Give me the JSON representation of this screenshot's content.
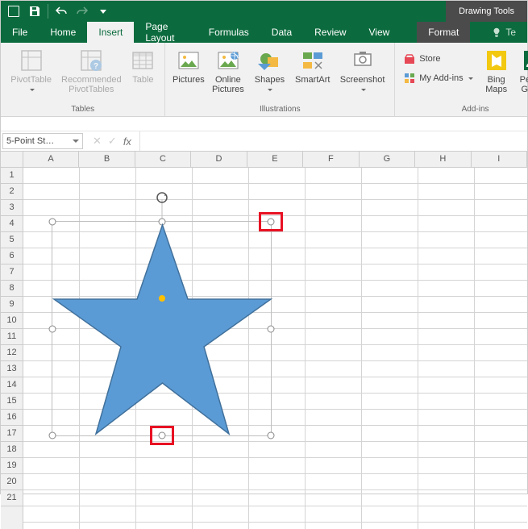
{
  "title_context": "Drawing Tools",
  "tabs": {
    "file": "File",
    "home": "Home",
    "insert": "Insert",
    "page_layout": "Page Layout",
    "formulas": "Formulas",
    "data": "Data",
    "review": "Review",
    "view": "View",
    "format": "Format",
    "tell": "Te"
  },
  "ribbon": {
    "tables": {
      "label": "Tables",
      "pivottable": "PivotTable",
      "recommended": "Recommended\nPivotTables",
      "table": "Table"
    },
    "illustrations": {
      "label": "Illustrations",
      "pictures": "Pictures",
      "online_pictures": "Online\nPictures",
      "shapes": "Shapes",
      "smartart": "SmartArt",
      "screenshot": "Screenshot"
    },
    "addins": {
      "label": "Add-ins",
      "store": "Store",
      "my_addins": "My Add-ins",
      "bing": "Bing\nMaps",
      "people": "People\nGraph"
    }
  },
  "namebox": "5-Point St…",
  "fx_label": "fx",
  "columns": [
    "A",
    "B",
    "C",
    "D",
    "E",
    "F",
    "G",
    "H",
    "I"
  ],
  "rows": [
    "1",
    "2",
    "3",
    "4",
    "5",
    "6",
    "7",
    "8",
    "9",
    "10",
    "11",
    "12",
    "13",
    "14",
    "15",
    "16",
    "17",
    "18",
    "19",
    "20",
    "21"
  ]
}
